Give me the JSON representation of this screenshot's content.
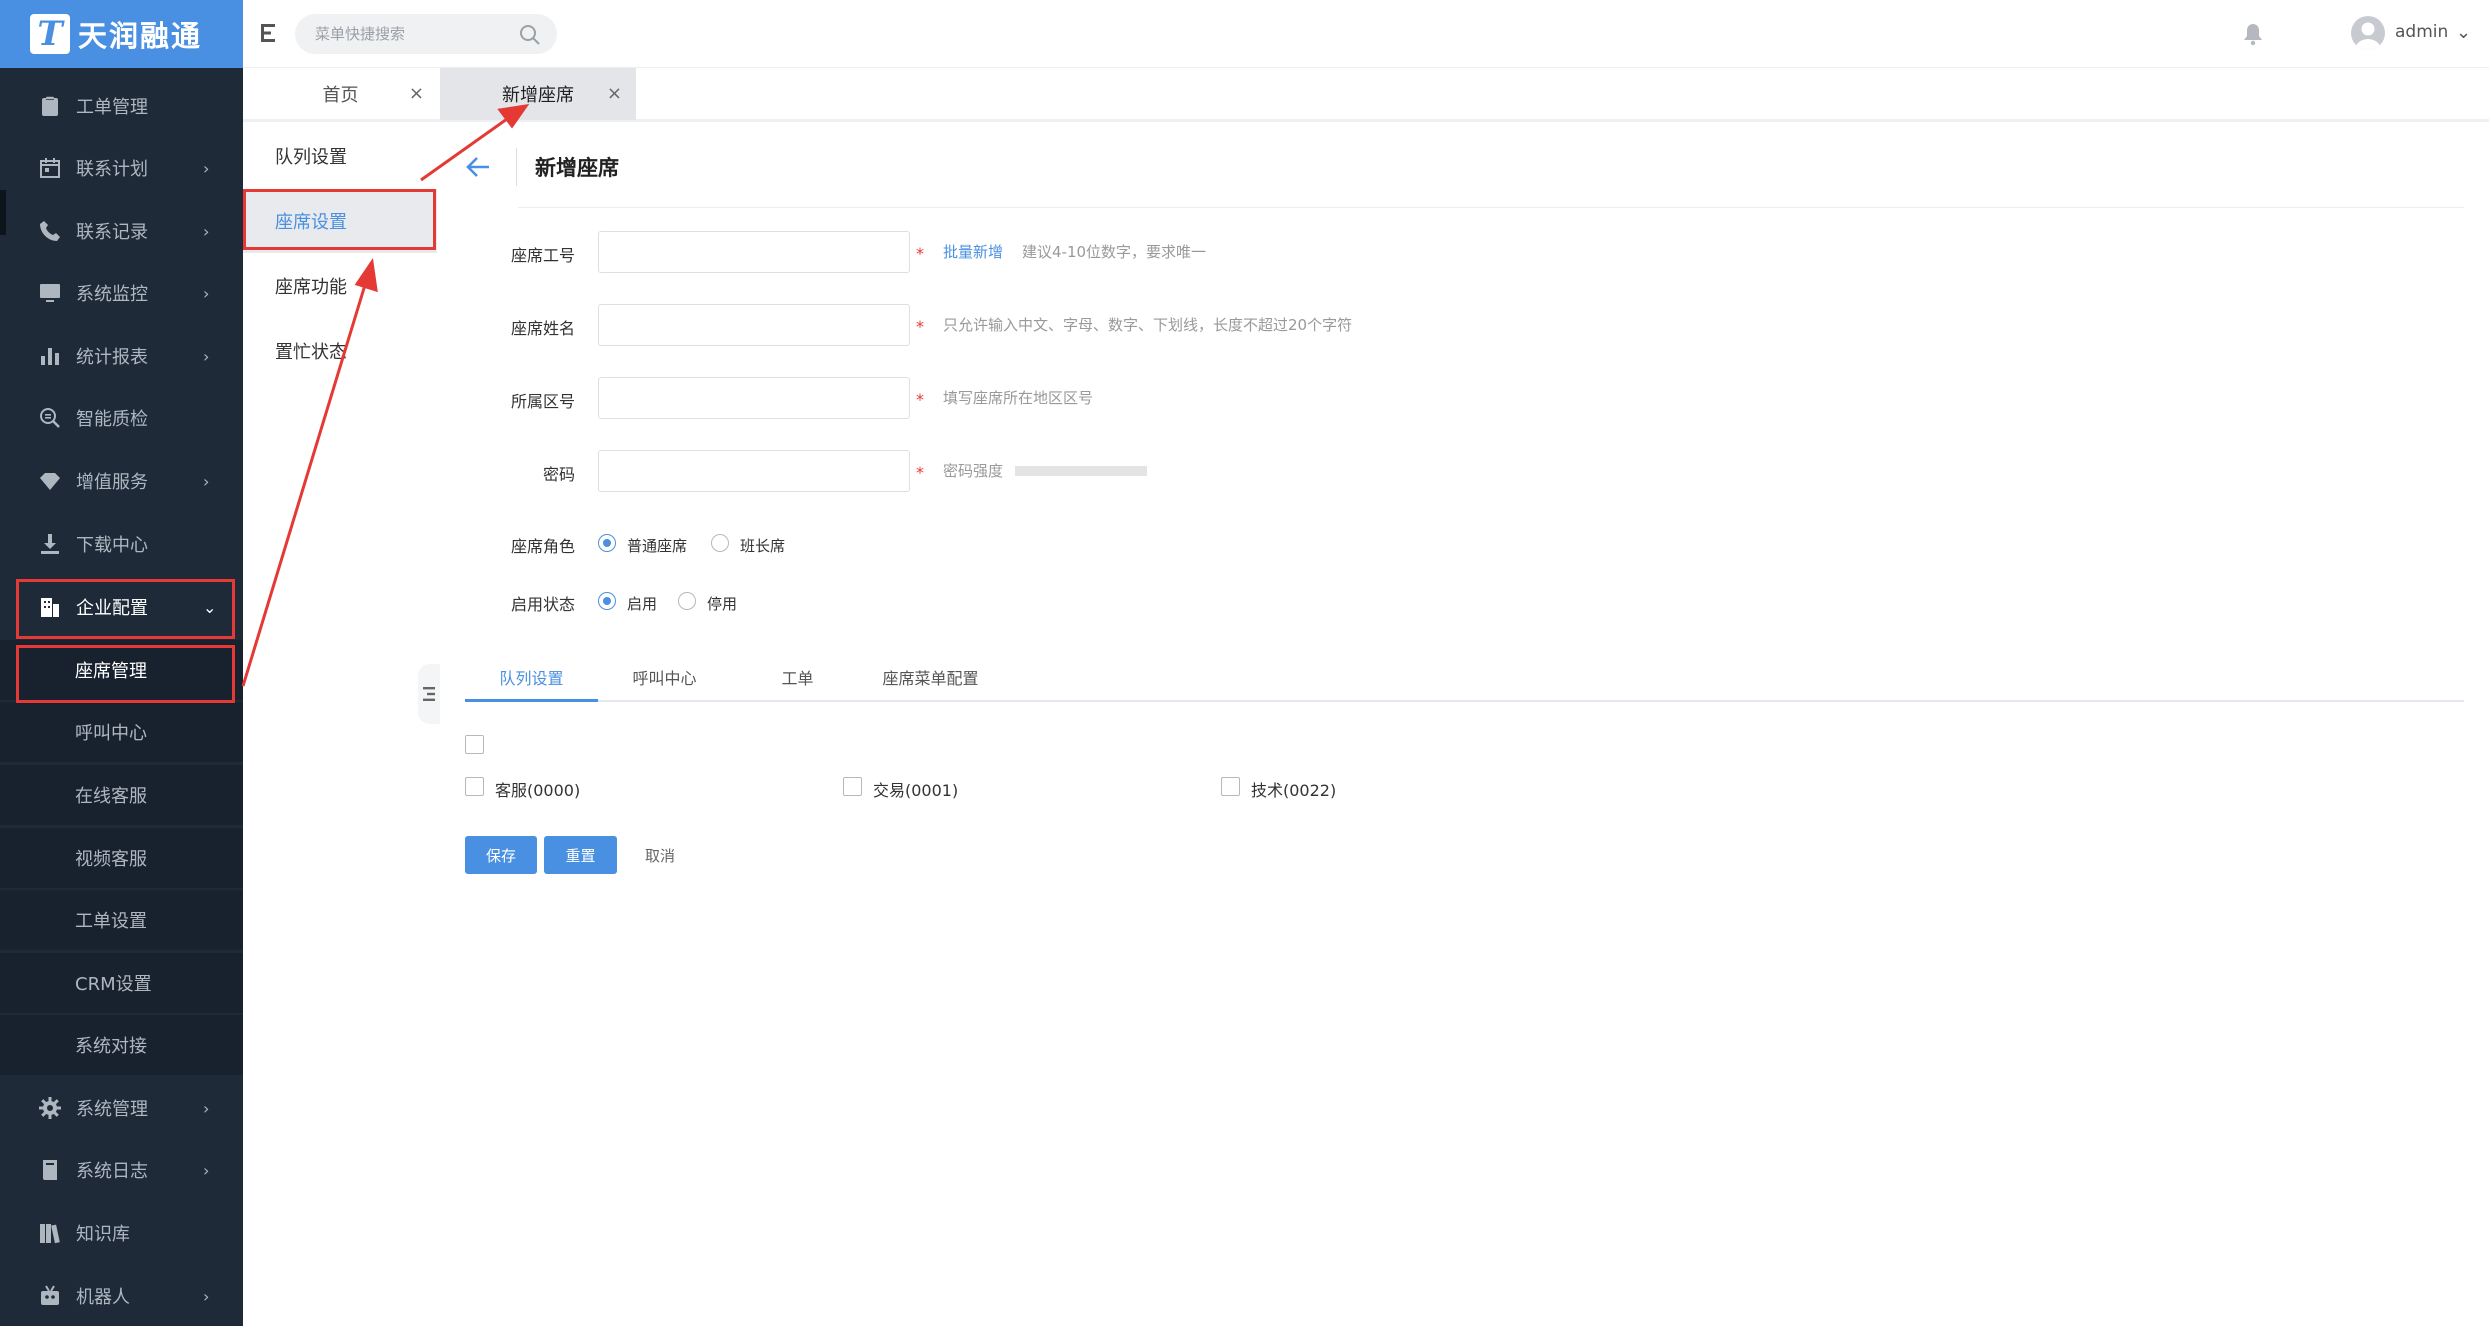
{
  "brand": {
    "logo_letter": "T",
    "name": "天润融通"
  },
  "sidebar": {
    "items": [
      {
        "label": "工单管理",
        "icon": "clipboard-icon",
        "chevron": ""
      },
      {
        "label": "联系计划",
        "icon": "calendar-icon",
        "chevron": "›"
      },
      {
        "label": "联系记录",
        "icon": "phone-icon",
        "chevron": "›"
      },
      {
        "label": "系统监控",
        "icon": "monitor-icon",
        "chevron": "›"
      },
      {
        "label": "统计报表",
        "icon": "bar-chart-icon",
        "chevron": "›"
      },
      {
        "label": "智能质检",
        "icon": "search-list-icon",
        "chevron": ""
      },
      {
        "label": "增值服务",
        "icon": "diamond-icon",
        "chevron": "›"
      },
      {
        "label": "下载中心",
        "icon": "download-icon",
        "chevron": ""
      },
      {
        "label": "企业配置",
        "icon": "building-icon",
        "chevron": "⌄"
      }
    ],
    "subitems": [
      "座席管理",
      "呼叫中心",
      "在线客服",
      "视频客服",
      "工单设置",
      "CRM设置",
      "系统对接"
    ],
    "bottom_items": [
      {
        "label": "系统管理",
        "icon": "gear-icon",
        "chevron": "›"
      },
      {
        "label": "系统日志",
        "icon": "book-icon",
        "chevron": "›"
      },
      {
        "label": "知识库",
        "icon": "books-icon",
        "chevron": ""
      },
      {
        "label": "机器人",
        "icon": "robot-icon",
        "chevron": "›"
      }
    ]
  },
  "topbar": {
    "search_placeholder": "菜单快捷搜索",
    "user": "admin"
  },
  "tabs": [
    {
      "label": "首页",
      "close": "×"
    },
    {
      "label": "新增座席",
      "close": "×"
    }
  ],
  "secondary_menu": [
    "队列设置",
    "座席设置",
    "座席功能",
    "置忙状态"
  ],
  "form": {
    "title": "新增座席",
    "fields": {
      "agent_id": {
        "label": "座席工号",
        "value": "",
        "required": "*",
        "link": "批量新增",
        "hint": "建议4-10位数字，要求唯一"
      },
      "agent_name": {
        "label": "座席姓名",
        "value": "",
        "required": "*",
        "hint": "只允许输入中文、字母、数字、下划线，长度不超过20个字符"
      },
      "area_code": {
        "label": "所属区号",
        "value": "",
        "required": "*",
        "hint": "填写座席所在地区区号"
      },
      "password": {
        "label": "密码",
        "value": "",
        "required": "*",
        "hint": "密码强度"
      }
    },
    "role": {
      "label": "座席角色",
      "options": [
        "普通座席",
        "班长席"
      ],
      "selected": "普通座席"
    },
    "status": {
      "label": "启用状态",
      "options": [
        "启用",
        "停用"
      ],
      "selected": "启用"
    },
    "tabs": [
      "队列设置",
      "呼叫中心",
      "工单",
      "座席菜单配置"
    ],
    "active_tab": "队列设置",
    "queues": [
      "客服(0000)",
      "交易(0001)",
      "技术(0022)"
    ],
    "buttons": {
      "save": "保存",
      "reset": "重置",
      "cancel": "取消"
    }
  },
  "colors": {
    "primary": "#4a90e2",
    "sidebar_bg": "#1e2a38",
    "annotation": "#e53935"
  }
}
